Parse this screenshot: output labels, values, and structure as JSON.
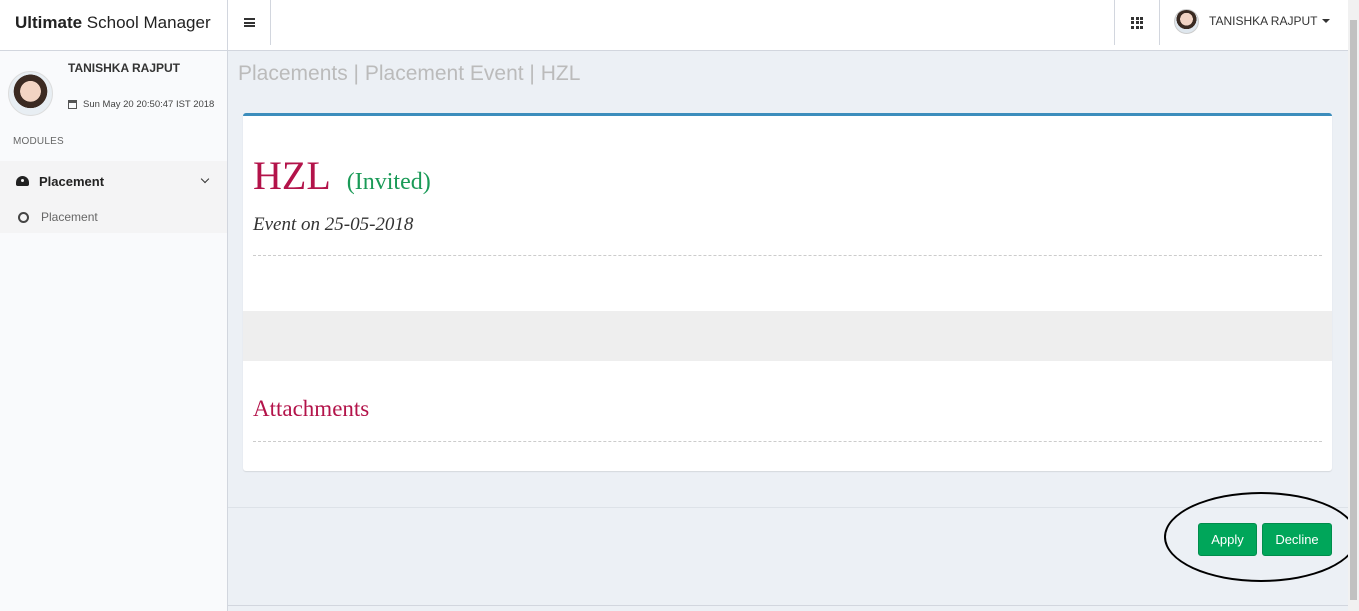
{
  "brand": {
    "bold": "Ultimate",
    "rest": " School Manager"
  },
  "topbar": {
    "user_name": "TANISHKA RAJPUT",
    "menu_icon": "hamburger-icon",
    "apps_icon": "grid-icon"
  },
  "sidebar": {
    "user_name": "TANISHKA RAJPUT",
    "datetime": "Sun May 20 20:50:47 IST 2018",
    "section_label": "MODULES",
    "menu": {
      "label": "Placement",
      "sub_items": [
        {
          "label": "Placement"
        }
      ]
    }
  },
  "breadcrumb": "Placements | Placement Event | HZL",
  "event": {
    "company": "HZL",
    "status": "(Invited)",
    "date_text": "Event on 25-05-2018",
    "attachments_heading": "Attachments"
  },
  "actions": {
    "apply_label": "Apply",
    "decline_label": "Decline"
  },
  "colors": {
    "accent": "#3c8dbc",
    "title": "#b3134a",
    "status": "#1a9a57",
    "button": "#00a65a"
  }
}
